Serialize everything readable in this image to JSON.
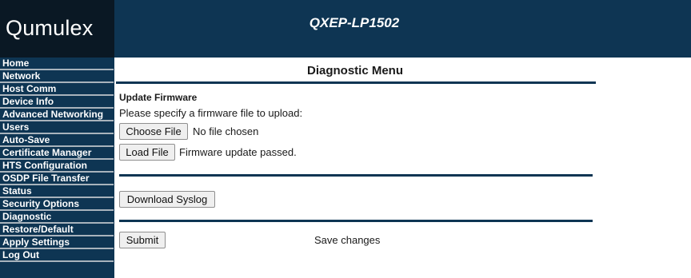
{
  "brand": {
    "logo": "Qumulex",
    "device_model": "QXEP-LP1502"
  },
  "nav": {
    "items": [
      "Home",
      "Network",
      "Host Comm",
      "Device Info",
      "Advanced Networking",
      "Users",
      "Auto-Save",
      "Certificate Manager",
      "HTS Configuration",
      "OSDP File Transfer",
      "Status",
      "Security Options",
      "Diagnostic",
      "Restore/Default",
      "Apply Settings",
      "Log Out"
    ]
  },
  "page": {
    "title": "Diagnostic Menu",
    "firmware": {
      "heading": "Update Firmware",
      "instruction": "Please specify a firmware file to upload:",
      "choose_label": "Choose File",
      "no_file_text": "No file chosen",
      "load_label": "Load File",
      "status_text": "Firmware update passed."
    },
    "syslog": {
      "download_label": "Download Syslog"
    },
    "submit": {
      "submit_label": "Submit",
      "save_note": "Save changes"
    }
  },
  "colors": {
    "brand_navy": "#0e3553",
    "logo_bg": "#0a1824",
    "nav_divider": "#a8b3bc"
  }
}
